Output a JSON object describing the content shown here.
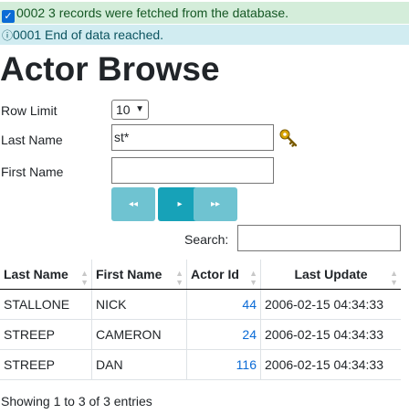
{
  "messages": {
    "success": "0002 3 records were fetched from the database.",
    "info": "0001 End of data reached.",
    "success_icon": "check-box-icon",
    "info_icon": "info-icon"
  },
  "page_title": "Actor Browse",
  "form": {
    "row_limit_label": "Row Limit",
    "row_limit_value": "10",
    "last_name_label": "Last Name",
    "last_name_value": "st*",
    "first_name_label": "First Name",
    "first_name_value": "",
    "lookup_icon": "key-icon"
  },
  "pager": {
    "first_glyph": "◂◂",
    "next_glyph": "▸",
    "last_glyph": "▸▸"
  },
  "search": {
    "label": "Search:",
    "value": ""
  },
  "table": {
    "columns": [
      "Last Name",
      "First Name",
      "Actor Id",
      "Last Update"
    ],
    "rows": [
      {
        "last_name": "STALLONE",
        "first_name": "NICK",
        "actor_id": "44",
        "last_update": "2006-02-15 04:34:33"
      },
      {
        "last_name": "STREEP",
        "first_name": "CAMERON",
        "actor_id": "24",
        "last_update": "2006-02-15 04:34:33"
      },
      {
        "last_name": "STREEP",
        "first_name": "DAN",
        "actor_id": "116",
        "last_update": "2006-02-15 04:34:33"
      }
    ]
  },
  "footer": {
    "info": "Showing 1 to 3 of 3 entries"
  },
  "colors": {
    "success_bg": "#d4edda",
    "info_bg": "#d1ecf1",
    "button": "#17a2b8",
    "link": "#0b6bd6"
  }
}
